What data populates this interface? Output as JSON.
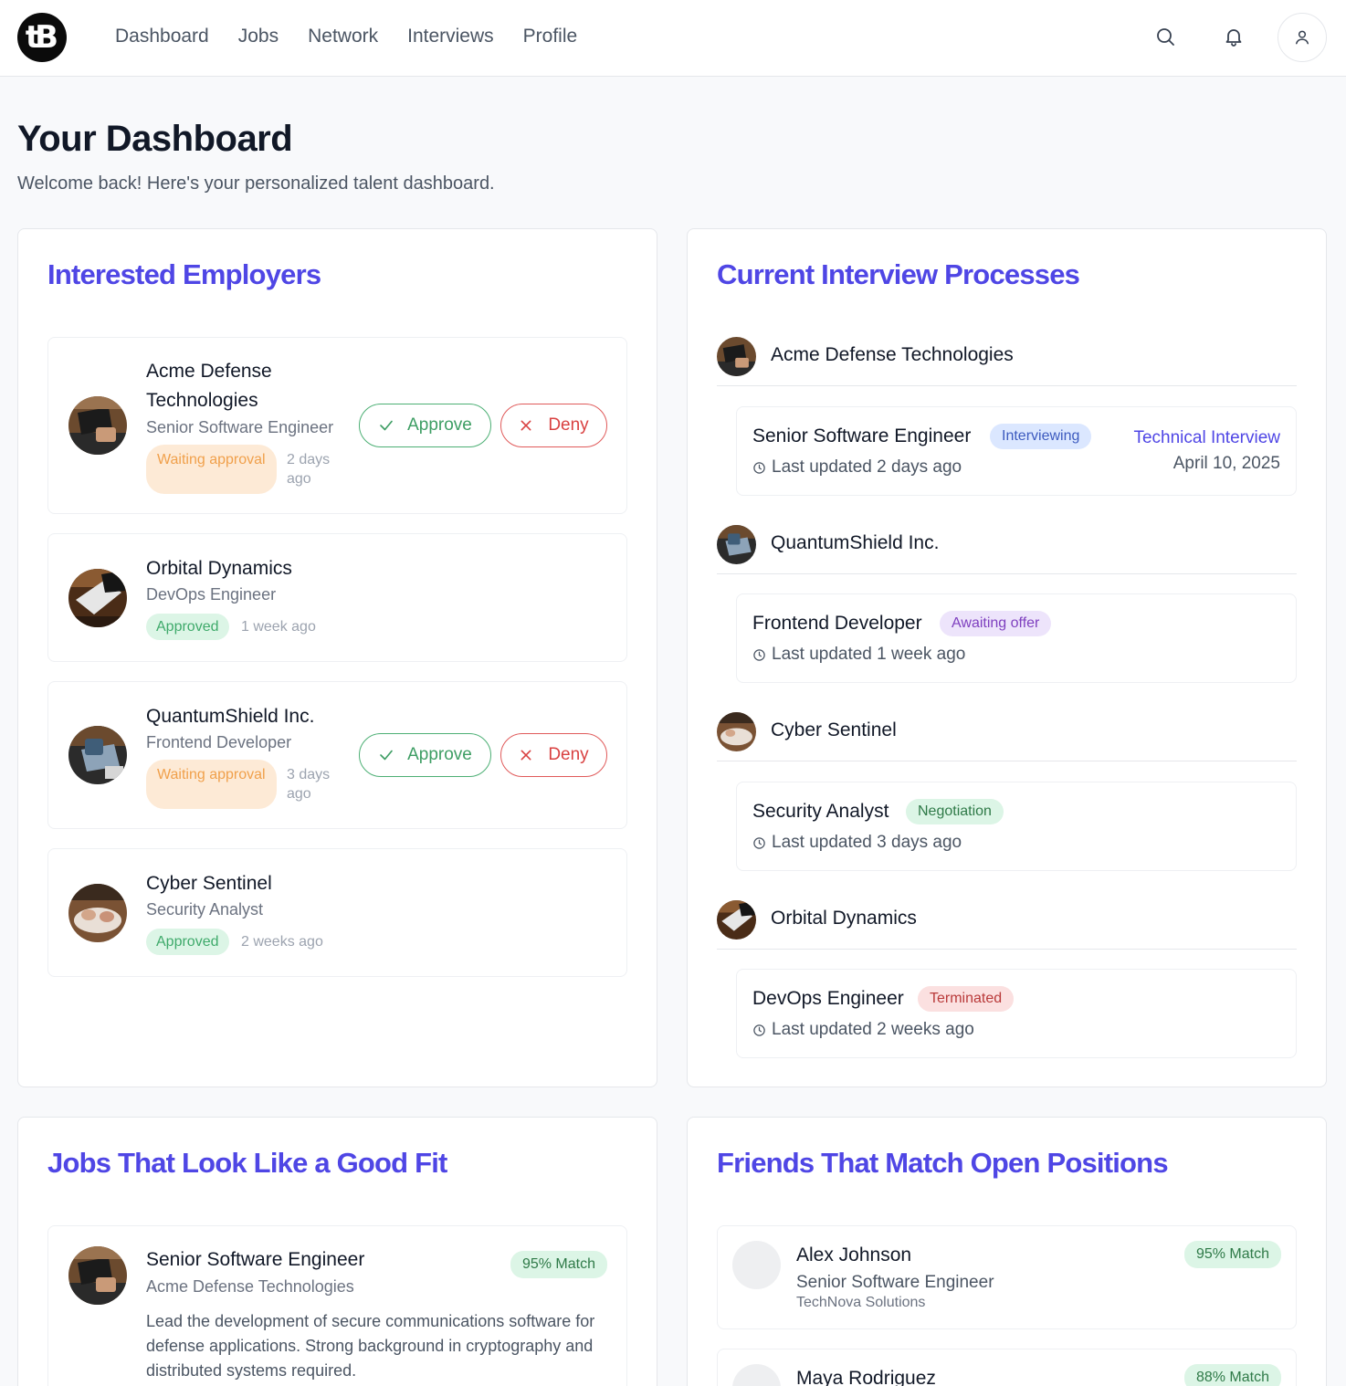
{
  "nav": {
    "logo_text": "tB",
    "links": [
      "Dashboard",
      "Jobs",
      "Network",
      "Interviews",
      "Profile"
    ]
  },
  "header": {
    "title": "Your Dashboard",
    "subtitle": "Welcome back! Here's your personalized talent dashboard."
  },
  "employers": {
    "title": "Interested Employers",
    "approve_label": "Approve",
    "deny_label": "Deny",
    "items": [
      {
        "name": "Acme Defense Technologies",
        "role": "Senior Software Engineer",
        "status": "Waiting approval",
        "ago": "2 days ago"
      },
      {
        "name": "Orbital Dynamics",
        "role": "DevOps Engineer",
        "status": "Approved",
        "ago": "1 week ago"
      },
      {
        "name": "QuantumShield Inc.",
        "role": "Frontend Developer",
        "status": "Waiting approval",
        "ago": "3 days ago"
      },
      {
        "name": "Cyber Sentinel",
        "role": "Security Analyst",
        "status": "Approved",
        "ago": "2 weeks ago"
      }
    ]
  },
  "processes": {
    "title": "Current Interview Processes",
    "items": [
      {
        "company": "Acme Defense Technologies",
        "role": "Senior Software Engineer",
        "status": "Interviewing",
        "updated": "Last updated 2 days ago",
        "next_step": "Technical Interview",
        "next_date": "April 10, 2025"
      },
      {
        "company": "QuantumShield Inc.",
        "role": "Frontend Developer",
        "status": "Awaiting offer",
        "updated": "Last updated 1 week ago"
      },
      {
        "company": "Cyber Sentinel",
        "role": "Security Analyst",
        "status": "Negotiation",
        "updated": "Last updated 3 days ago"
      },
      {
        "company": "Orbital Dynamics",
        "role": "DevOps Engineer",
        "status": "Terminated",
        "updated": "Last updated 2 weeks ago"
      }
    ]
  },
  "jobs": {
    "title": "Jobs That Look Like a Good Fit",
    "items": [
      {
        "role": "Senior Software Engineer",
        "company": "Acme Defense Technologies",
        "match": "95% Match",
        "description": "Lead the development of secure communications software for defense applications. Strong background in cryptography and distributed systems required."
      }
    ]
  },
  "friends": {
    "title": "Friends That Match Open Positions",
    "items": [
      {
        "name": "Alex Johnson",
        "role": "Senior Software Engineer",
        "company": "TechNova Solutions",
        "match": "95% Match"
      },
      {
        "name": "Maya Rodriguez",
        "match": "88% Match"
      }
    ]
  },
  "colors": {
    "accent": "#4f46e5",
    "approve": "#3e9e64",
    "deny": "#d94141",
    "waiting_bg": "#fdead6",
    "approved_bg": "#dcf5e6"
  }
}
